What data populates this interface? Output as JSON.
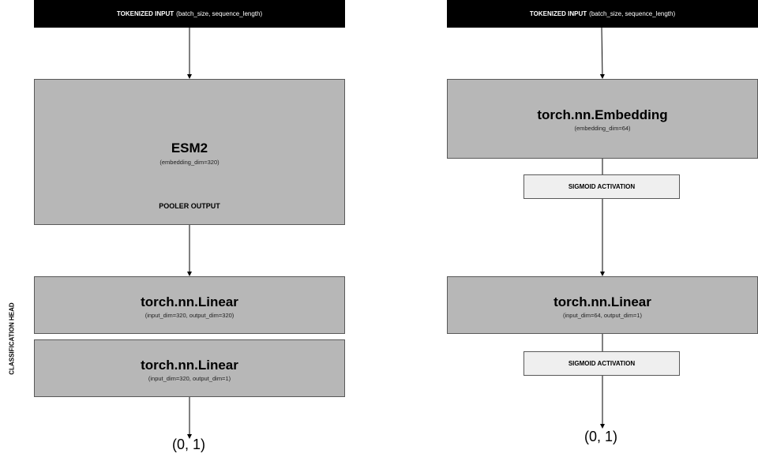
{
  "left": {
    "input": {
      "bold": "TOKENIZED INPUT",
      "rest": "(batch_size, sequence_length)"
    },
    "esm": {
      "title": "ESM2",
      "sub": "(embedding_dim=320)",
      "pooler": "POOLER OUTPUT"
    },
    "side_label": "CLASSIFICATION HEAD",
    "linear1": {
      "title": "torch.nn.Linear",
      "sub": "(input_dim=320, output_dim=320)"
    },
    "linear2": {
      "title": "torch.nn.Linear",
      "sub": "(input_dim=320, output_dim=1)"
    },
    "output": "(0, 1)"
  },
  "right": {
    "input": {
      "bold": "TOKENIZED INPUT",
      "rest": "(batch_size, sequence_length)"
    },
    "embedding": {
      "title": "torch.nn.Embedding",
      "sub": "(embedding_dim=64)"
    },
    "sigmoid1": "SIGMOID ACTIVATION",
    "linear": {
      "title": "torch.nn.Linear",
      "sub": "(input_dim=64, output_dim=1)"
    },
    "sigmoid2": "SIGMOID ACTIVATION",
    "output": "(0, 1)"
  },
  "colors": {
    "input_bar": "#000000",
    "block": "#b7b7b7",
    "activation": "#efefef",
    "border": "#595959"
  }
}
